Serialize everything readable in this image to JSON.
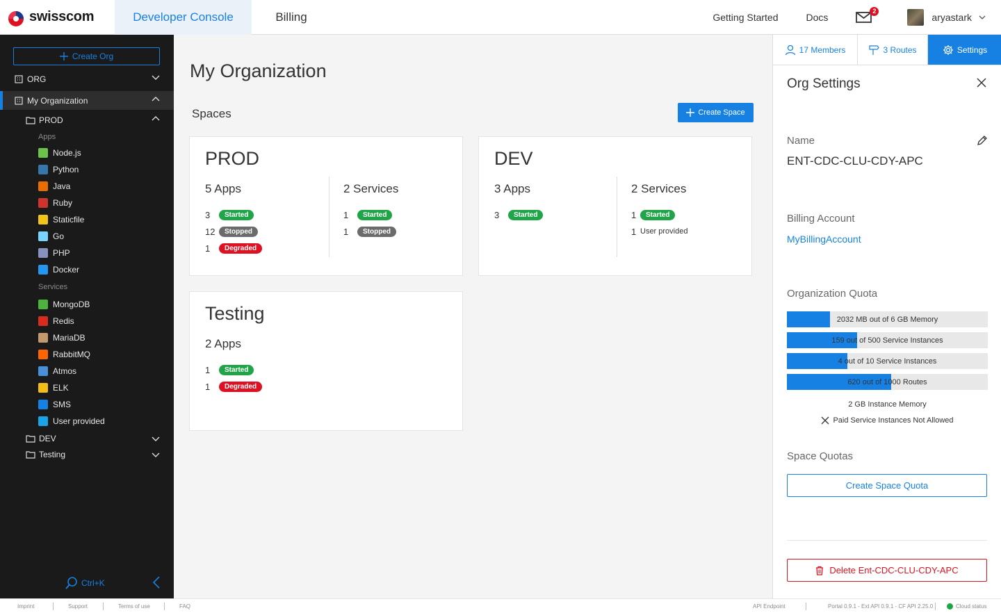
{
  "header": {
    "brand": "swisscom",
    "tabs": [
      {
        "label": "Developer Console",
        "active": true
      },
      {
        "label": "Billing",
        "active": false
      }
    ],
    "links": [
      "Getting Started",
      "Docs"
    ],
    "mail_count": "2",
    "username": "aryastark"
  },
  "sidebar": {
    "create_org_label": "Create Org",
    "org_label": "ORG",
    "current_org": "My Organization",
    "spaces": {
      "prod": "PROD",
      "dev": "DEV",
      "testing": "Testing"
    },
    "apps_header": "Apps",
    "apps": [
      {
        "label": "Node.js",
        "icon": "nodejs-icon",
        "color": "#6cc24a"
      },
      {
        "label": "Python",
        "icon": "python-icon",
        "color": "#3776ab"
      },
      {
        "label": "Java",
        "icon": "java-icon",
        "color": "#e76f00"
      },
      {
        "label": "Ruby",
        "icon": "ruby-icon",
        "color": "#cc342d"
      },
      {
        "label": "Staticfile",
        "icon": "staticfile-icon",
        "color": "#f0c419"
      },
      {
        "label": "Go",
        "icon": "go-icon",
        "color": "#79d4fd"
      },
      {
        "label": "PHP",
        "icon": "php-icon",
        "color": "#8892bf"
      },
      {
        "label": "Docker",
        "icon": "docker-icon",
        "color": "#2496ed"
      }
    ],
    "services_header": "Services",
    "services": [
      {
        "label": "MongoDB",
        "icon": "mongodb-icon",
        "color": "#4db33d"
      },
      {
        "label": "Redis",
        "icon": "redis-icon",
        "color": "#d82c20"
      },
      {
        "label": "MariaDB",
        "icon": "mariadb-icon",
        "color": "#c49a6c"
      },
      {
        "label": "RabbitMQ",
        "icon": "rabbitmq-icon",
        "color": "#ff6600"
      },
      {
        "label": "Atmos",
        "icon": "atmos-icon",
        "color": "#4a90d9"
      },
      {
        "label": "ELK",
        "icon": "elk-icon",
        "color": "#f3bd19"
      },
      {
        "label": "SMS",
        "icon": "sms-icon",
        "color": "#1781e3"
      },
      {
        "label": "User provided",
        "icon": "puzzle-icon",
        "color": "#1aa3e8"
      }
    ],
    "shortcut": "Ctrl+K"
  },
  "main": {
    "title": "My Organization",
    "spaces_label": "Spaces",
    "create_space_label": "Create Space",
    "cards": [
      {
        "name": "PROD",
        "apps_title": "5 Apps",
        "apps": [
          {
            "count": "3",
            "status": "Started"
          },
          {
            "count": "12",
            "status": "Stopped"
          },
          {
            "count": "1",
            "status": "Degraded"
          }
        ],
        "services_title": "2 Services",
        "services": [
          {
            "count": "1",
            "status": "Started"
          },
          {
            "count": "1",
            "status": "Stopped"
          }
        ]
      },
      {
        "name": "DEV",
        "apps_title": "3 Apps",
        "apps": [
          {
            "count": "3",
            "status": "Started"
          }
        ],
        "services_title": "2 Services",
        "services": [
          {
            "count": "1",
            "status": "Started"
          },
          {
            "count": "1",
            "status": "User provided"
          }
        ]
      },
      {
        "name": "Testing",
        "apps_title": "2 Apps",
        "apps": [
          {
            "count": "1",
            "status": "Started"
          },
          {
            "count": "1",
            "status": "Degraded"
          }
        ]
      }
    ]
  },
  "panel": {
    "tabs": [
      {
        "label": "17 Members",
        "active": false
      },
      {
        "label": "3 Routes",
        "active": false
      },
      {
        "label": "Settings",
        "active": true
      }
    ],
    "title": "Org Settings",
    "name_label": "Name",
    "name_value": "ENT-CDC-CLU-CDY-APC",
    "billing_label": "Billing Account",
    "billing_value": "MyBillingAccount",
    "quota_label": "Organization Quota",
    "quotas": [
      {
        "text": "2032 MB out of 6 GB Memory",
        "fraction": 0.215
      },
      {
        "text": "159 out of 500 Service Instances",
        "fraction": 0.35
      },
      {
        "text": "4 out of 10 Service Instances",
        "fraction": 0.3
      },
      {
        "text": "620 out of 1000 Routes",
        "fraction": 0.52
      }
    ],
    "instance_memory": "2 GB Instance Memory",
    "paid_services": "Paid Service Instances Not Allowed",
    "space_quotas_label": "Space Quotas",
    "create_quota_label": "Create Space Quota",
    "delete_label": "Delete Ent-CDC-CLU-CDY-APC"
  },
  "footer": {
    "links": [
      "Imprint",
      "Support",
      "Terms of use",
      "FAQ"
    ],
    "api_endpoint": "API Endpoint",
    "version": "Portal 0.9.1 - Ext API 0.9.1 - CF API 2.25.0",
    "cloud_status": "Cloud status"
  },
  "colors": {
    "accent": "#1781e3",
    "started": "#1fa447",
    "stopped": "#6b6b6b",
    "degraded": "#dd1122",
    "sidebar_bg": "#1a1a1a"
  }
}
